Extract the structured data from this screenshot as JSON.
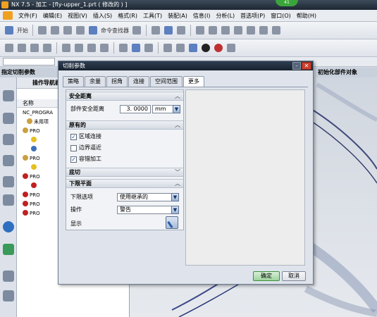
{
  "app": {
    "title": "NX 7.5 - 加工 - [fly-upper_1.prt  ( 修改的 ) ]",
    "badge": "41"
  },
  "menu": [
    "文件(F)",
    "编辑(E)",
    "视图(V)",
    "插入(S)",
    "格式(R)",
    "工具(T)",
    "装配(A)",
    "信息(I)",
    "分析(L)",
    "首选项(P)",
    "窗口(O)",
    "帮助(H)"
  ],
  "toolbar1": {
    "start_label": "开始",
    "cmd_finder_label": "命令查找器"
  },
  "left_panel": {
    "title": "指定切削参数",
    "navigator_title": "操作导航器",
    "column_name": "名称"
  },
  "navigator_rows": [
    "NC_PROGRA",
    "未用项",
    "PRO",
    "",
    "",
    "PRO",
    "",
    "PRO",
    "",
    "PRO",
    "PRO",
    "PRO"
  ],
  "right_panel": {
    "title": "初始化部件对象"
  },
  "dialog": {
    "title": "切削参数",
    "tabs": [
      "策略",
      "余量",
      "拐角",
      "连接",
      "空间范围",
      "更多"
    ],
    "active_tab": "更多",
    "sections": {
      "safety": {
        "header": "安全距离",
        "part_clearance_label": "部件安全距离",
        "part_clearance_value": "3. 0000",
        "unit": "mm"
      },
      "original": {
        "header": "原有的",
        "options": [
          {
            "label": "区域连接",
            "checked": true
          },
          {
            "label": "边界逼近",
            "checked": false
          },
          {
            "label": "容错加工",
            "checked": true
          }
        ]
      },
      "bottom_cut": {
        "header": "底切"
      },
      "lower_plane": {
        "header": "下限平面",
        "lower_option_label": "下限选项",
        "lower_option_value": "使用继承的",
        "operation_label": "操作",
        "operation_value": "警告",
        "display_label": "显示"
      }
    },
    "ok_label": "确定",
    "cancel_label": "取消"
  }
}
